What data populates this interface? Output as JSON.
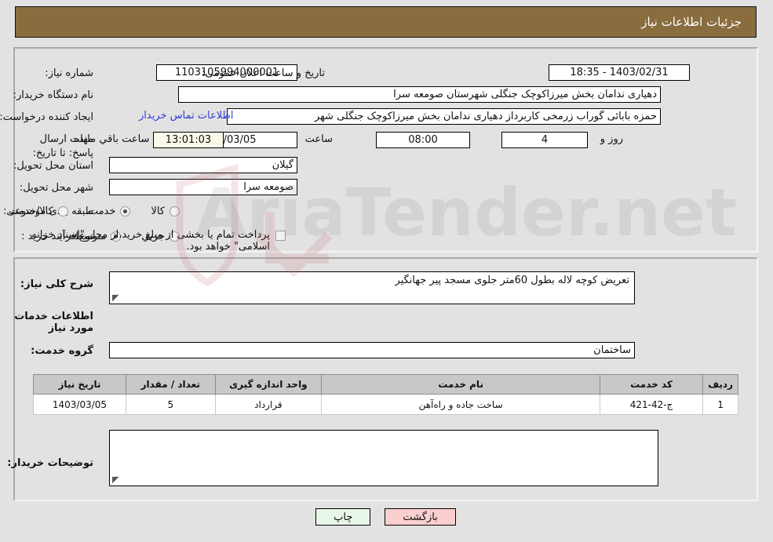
{
  "header": {
    "title": "جزئیات اطلاعات نیاز",
    "bg": "#8a6d3f",
    "fg": "#ffffff"
  },
  "form": {
    "need_number_label": "شماره نیاز:",
    "need_number_value": "1103105994000001",
    "announce_datetime_label": "تاریخ و ساعت اعلان عمومی:",
    "announce_datetime_value": "1403/02/31 - 18:35",
    "buyer_org_label": "نام دستگاه خریدار:",
    "buyer_org_value": "دهیاری ندامان بخش میرزاکوچک جنگلی شهرستان صومعه سرا",
    "request_creator_label": "ایجاد کننده درخواست:",
    "request_creator_value": "حمزه بابائی گوراب زرمخی کاربرداز دهیاری ندامان بخش میرزاکوچک جنگلی شهر",
    "buyer_contact_link": "اطلاعات تماس خریدار",
    "deadline_label": "مهلت ارسال پاسخ: تا تاریخ:",
    "deadline_date": "1403/03/05",
    "deadline_time_label": "ساعت",
    "deadline_time": "08:00",
    "days_left": "4",
    "days_left_label": "روز و",
    "countdown": "13:01:03",
    "countdown_label": "ساعت باقي مانده",
    "province_label": "استان محل تحویل:",
    "province_value": "گیلان",
    "city_label": "شهر محل تحویل:",
    "city_value": "صومعه سرا",
    "category_label": "طبقه بندی موضوعی:",
    "category_options": [
      {
        "label": "کالا",
        "selected": false
      },
      {
        "label": "خدمت",
        "selected": true
      },
      {
        "label": "کالا/خدمت",
        "selected": false
      }
    ],
    "process_label": "نوع فرآیند خرید :",
    "process_options": [
      {
        "label": "جزیي",
        "selected": false
      },
      {
        "label": "متوسط",
        "selected": true
      }
    ],
    "treasury_checkbox_checked": false,
    "treasury_text": "پرداخت تمام یا بخشی از مبلغ خرید،از محل \"اسناد خزانه اسلامی\" خواهد بود."
  },
  "description": {
    "label": "شرح کلی نیاز:",
    "value": "تعریض کوچه لاله بطول 60متر جلوی مسجد پیر جهانگیر"
  },
  "services": {
    "heading": "اطلاعات خدمات مورد نیاز",
    "group_label": "گروه خدمت:",
    "group_value": "ساختمان",
    "columns": [
      "ردیف",
      "کد خدمت",
      "نام خدمت",
      "واحد اندازه گیری",
      "تعداد / مقدار",
      "تاریخ نیاز"
    ],
    "rows": [
      {
        "row": "1",
        "code": "ج-42-421",
        "name": "ساخت جاده و راه‌آهن",
        "unit": "قرارداد",
        "qty": "5",
        "date": "1403/03/05"
      }
    ]
  },
  "buyer_notes": {
    "label": "توضیحات خریدار:",
    "value": ""
  },
  "buttons": {
    "print": "چاپ",
    "back": "بازگشت"
  },
  "watermark": {
    "text": "AriaTender.net"
  }
}
